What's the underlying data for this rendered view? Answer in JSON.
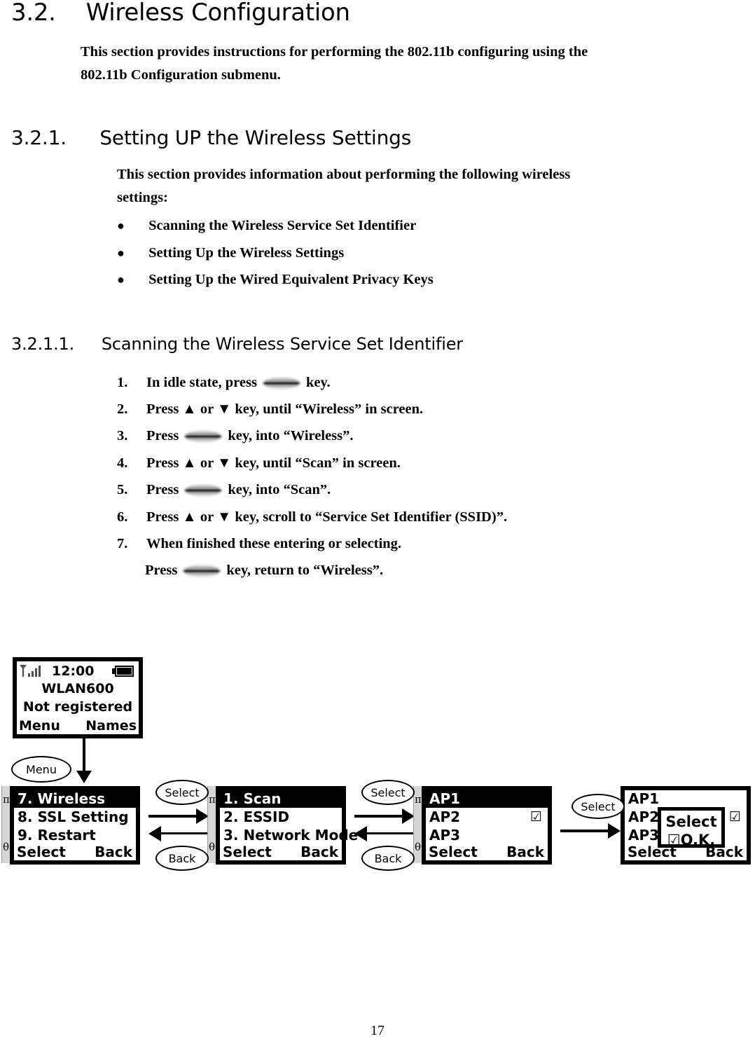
{
  "document": {
    "section_2": {
      "number": "3.2.",
      "title": "Wireless Configuration",
      "paragraph_line1": "This section provides instructions for performing the 802.11b configuring using the",
      "paragraph_line2": "802.11b Configuration submenu."
    },
    "section_2_1": {
      "number": "3.2.1.",
      "title": "Setting UP the Wireless Settings",
      "paragraph_line1": "This section provides information about performing the following wireless",
      "paragraph_line2": "settings:",
      "bullets": [
        "Scanning the Wireless Service Set Identifier",
        "Setting Up the Wireless Settings",
        "Setting Up the Wired Equivalent Privacy Keys"
      ],
      "bullet_glyph": "●"
    },
    "section_2_1_1": {
      "number": "3.2.1.1.",
      "title": "Scanning the Wireless Service Set Identifier",
      "steps": [
        {
          "index": "1.",
          "before": "In idle state, press",
          "key": "nav-key",
          "after": "key."
        },
        {
          "index": "2.",
          "before": "Press ▲ or ▼ key, until “Wireless” in screen.",
          "key": "",
          "after": ""
        },
        {
          "index": "3.",
          "before": "Press",
          "key": "nav-key",
          "after": "key, into “Wireless”."
        },
        {
          "index": "4.",
          "before": "Press ▲ or ▼ key, until “Scan” in screen.",
          "key": "",
          "after": ""
        },
        {
          "index": "5.",
          "before": "Press",
          "key": "nav-key",
          "after": "key, into “Scan”."
        },
        {
          "index": "6.",
          "before": "Press ▲ or ▼ key, scroll to “Service Set Identifier (SSID)”.",
          "key": "",
          "after": ""
        },
        {
          "index": "7.",
          "before": "When finished these entering or selecting.",
          "key": "",
          "after": ""
        },
        {
          "index": "",
          "before": "Press",
          "key": "nav-key",
          "after": "key, return to “Wireless”."
        }
      ]
    },
    "page_number": "17"
  },
  "flow": {
    "idle_screen": {
      "signal_icon": "signal-bars-icon",
      "clock": "12:00",
      "battery_icon": "battery-full-icon",
      "title": "WLAN600",
      "subtitle": "Not registered",
      "softkey_left": "Menu",
      "softkey_right": "Names"
    },
    "callouts": {
      "menu": "Menu",
      "select": "Select",
      "back": "Back"
    },
    "scroll_rail": {
      "up_glyph": "π",
      "down_glyph": "θ"
    },
    "screens": [
      {
        "name": "wireless-menu",
        "rows": [
          {
            "label": "7. Wireless",
            "selected": true,
            "checked": false
          },
          {
            "label": "8. SSL Setting",
            "selected": false,
            "checked": false
          },
          {
            "label": "9. Restart",
            "selected": false,
            "checked": false
          }
        ],
        "softkey_left": "Select",
        "softkey_right": "Back"
      },
      {
        "name": "wireless-submenu",
        "rows": [
          {
            "label": "1. Scan",
            "selected": true,
            "checked": false
          },
          {
            "label": "2. ESSID",
            "selected": false,
            "checked": false
          },
          {
            "label": "3. Network Mode",
            "selected": false,
            "checked": false
          }
        ],
        "softkey_left": "Select",
        "softkey_right": "Back"
      },
      {
        "name": "ap-list",
        "rows": [
          {
            "label": "AP1",
            "selected": true,
            "checked": false
          },
          {
            "label": "AP2",
            "selected": false,
            "checked": true
          },
          {
            "label": "AP3",
            "selected": false,
            "checked": false
          }
        ],
        "softkey_left": "Select",
        "softkey_right": "Back"
      },
      {
        "name": "ap-list-confirm",
        "rows": [
          {
            "label": "AP1",
            "selected": false,
            "checked": false
          },
          {
            "label": "AP2",
            "selected": false,
            "checked": true
          },
          {
            "label": "AP3",
            "selected": false,
            "checked": false
          }
        ],
        "softkey_left": "Select",
        "softkey_right": "Back",
        "popup": {
          "line1": "Select",
          "line2": "☑O.K."
        }
      }
    ],
    "check_glyph": "☑"
  }
}
